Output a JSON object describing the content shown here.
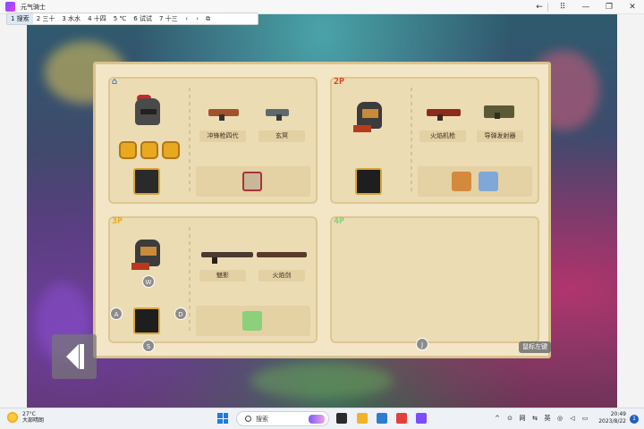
{
  "window": {
    "title": "元气骑士",
    "controls": [
      "←",
      "⠿",
      "—",
      "❐",
      "✕"
    ]
  },
  "toolstrip": {
    "items": [
      "1 搜索",
      "2 三十",
      "3 水水",
      "4 十四",
      "5 ℃",
      "6 试试",
      "7 十三"
    ],
    "prev": "‹",
    "next": "›",
    "extra": "⧉"
  },
  "players": {
    "p1": {
      "tag": "⌂",
      "weapons": [
        {
          "name": "冲锋枪四代"
        },
        {
          "name": "玄冥"
        }
      ],
      "badge_colors": [
        "#e8a81f"
      ]
    },
    "p2": {
      "tag": "2P",
      "weapons": [
        {
          "name": "火焰机枪"
        },
        {
          "name": "导弹发射器"
        }
      ]
    },
    "p3": {
      "tag": "3P",
      "weapons": [
        {
          "name": "魅影"
        },
        {
          "name": "火焰剑"
        }
      ],
      "keys": {
        "up": "W",
        "left": "A",
        "right": "D",
        "down": "S"
      }
    },
    "p4": {
      "tag": "4P",
      "key": "J"
    }
  },
  "hint": "鼠标左键",
  "colors": {
    "p1": "#3b6fd8",
    "p2": "#d8431f",
    "p3": "#e8a81f",
    "p4": "#7fd17a"
  },
  "taskbar": {
    "temperature": "27°C",
    "weather": "大部晴朗",
    "search_placeholder": "搜索",
    "tray": [
      "^",
      "⊙",
      "网",
      "⇆",
      "英",
      "◎",
      "◁",
      "▭"
    ],
    "time": "20:49",
    "date": "2023/8/22",
    "notifications": "1"
  }
}
